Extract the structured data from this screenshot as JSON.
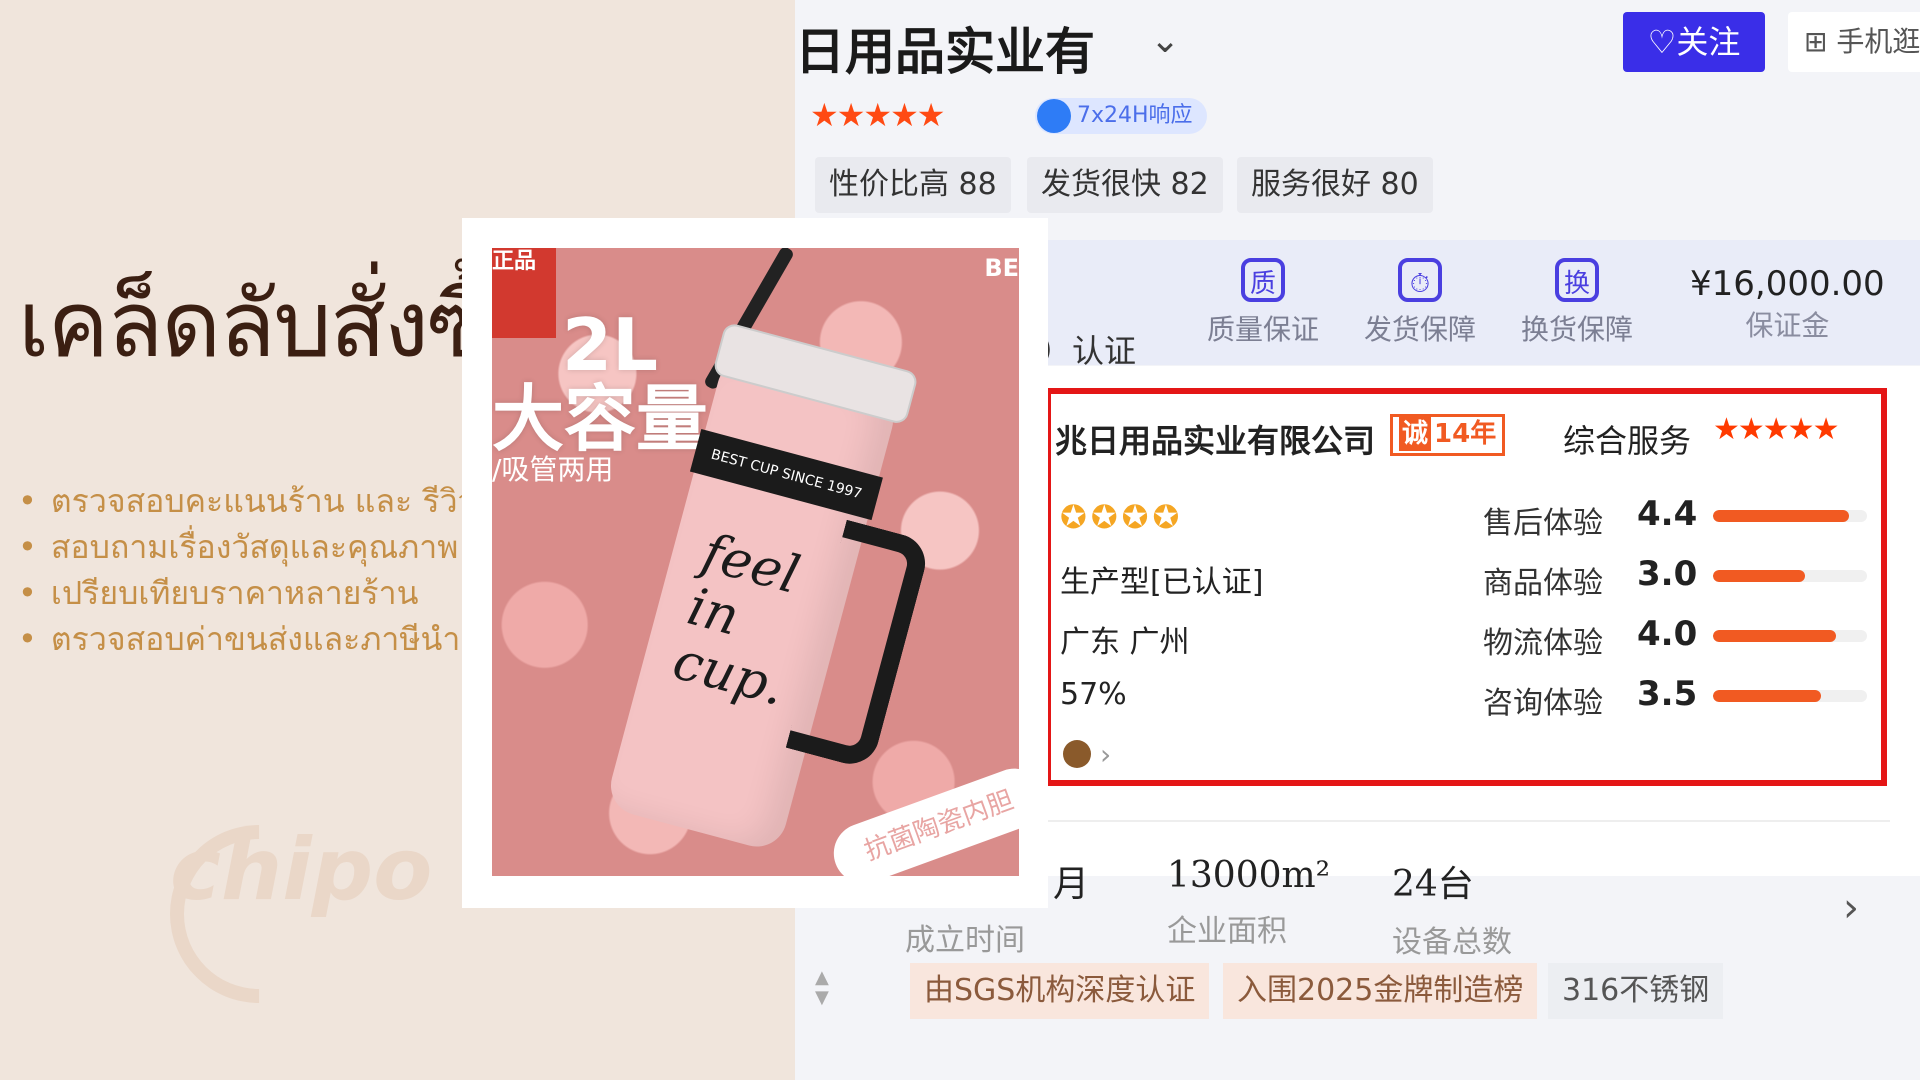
{
  "slide": {
    "title": "เคล็ดลับสั่งซื้อ",
    "bullets": [
      "ตรวจสอบคะแนนร้าน และ รีวิว",
      "สอบถามเรื่องวัสดุและคุณภาพ",
      "เปรียบเทียบราคาหลายร้าน",
      "ตรวจสอบค่าขนส่งและภาษีนำเข้า"
    ],
    "watermark": "chipo"
  },
  "store": {
    "name_partial": "日用品实业有",
    "follow_label": "关注",
    "mobile_label": "手机逛",
    "response_badge": "7x24H响应",
    "rating_tags": [
      "性价比高 88",
      "发货很快 82",
      "服务很好 80"
    ],
    "guarantees": [
      "质量保证",
      "发货保障",
      "换货保障"
    ],
    "guarantee_icons": [
      "质",
      "⏱",
      "换"
    ],
    "deposit_amount": "¥16,000.00",
    "deposit_label": "保证金",
    "cert_partial": "）认证"
  },
  "company_card": {
    "company_name": "兆日用品实业有限公司",
    "years_badge_char": "诚",
    "years_label": "14年",
    "service_label": "综合服务",
    "business_type": "生产型[已认证]",
    "location": "广东 广州",
    "percent": "57%",
    "ratings": [
      {
        "label": "售后体验",
        "value": "4.4",
        "fraction": 0.88
      },
      {
        "label": "商品体验",
        "value": "3.0",
        "fraction": 0.6
      },
      {
        "label": "物流体验",
        "value": "4.0",
        "fraction": 0.8
      },
      {
        "label": "咨询体验",
        "value": "3.5",
        "fraction": 0.7
      }
    ]
  },
  "stats": [
    {
      "value": "月",
      "label": "成立时间"
    },
    {
      "value": "13000m²",
      "label": "企业面积"
    },
    {
      "value": "24台",
      "label": "设备总数"
    }
  ],
  "bottom_tags": [
    "由SGS机构深度认证",
    "入围2025金牌制造榜",
    "316不锈钢"
  ],
  "product": {
    "corner": "正品",
    "headline_1": "2L",
    "headline_2": "大容量",
    "subline": "/吸管两用",
    "brand_corner": "BE",
    "band_text": "BEST CUP SINCE 1997",
    "cup_text": "feel in cup.",
    "banner": "抗菌陶瓷内胆"
  },
  "colors": {
    "accent_purple": "#3a2ee8",
    "rating_orange": "#f15a22",
    "highlight_red": "#e41616",
    "thai_title": "#3b1f12",
    "thai_bullets": "#c58f47"
  }
}
